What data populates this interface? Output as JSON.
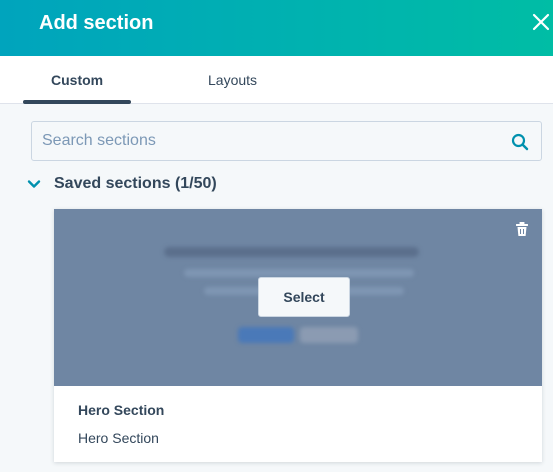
{
  "header": {
    "title": "Add section",
    "close_icon": "close-icon"
  },
  "tabs": [
    {
      "label": "Custom",
      "active": true
    },
    {
      "label": "Layouts",
      "active": false
    }
  ],
  "search": {
    "placeholder": "Search sections",
    "value": "",
    "icon": "search-icon"
  },
  "saved_sections": {
    "label": "Saved sections (1/50)",
    "expanded": true,
    "items": [
      {
        "select_label": "Select",
        "title": "Hero Section",
        "description": "Hero Section",
        "trash_icon": "trash-icon"
      }
    ]
  },
  "colors": {
    "header_start": "#00a4bd",
    "header_end": "#00bda5",
    "text": "#33475b",
    "accent_icon": "#0091ae",
    "preview_overlay": "#6f86a3"
  }
}
